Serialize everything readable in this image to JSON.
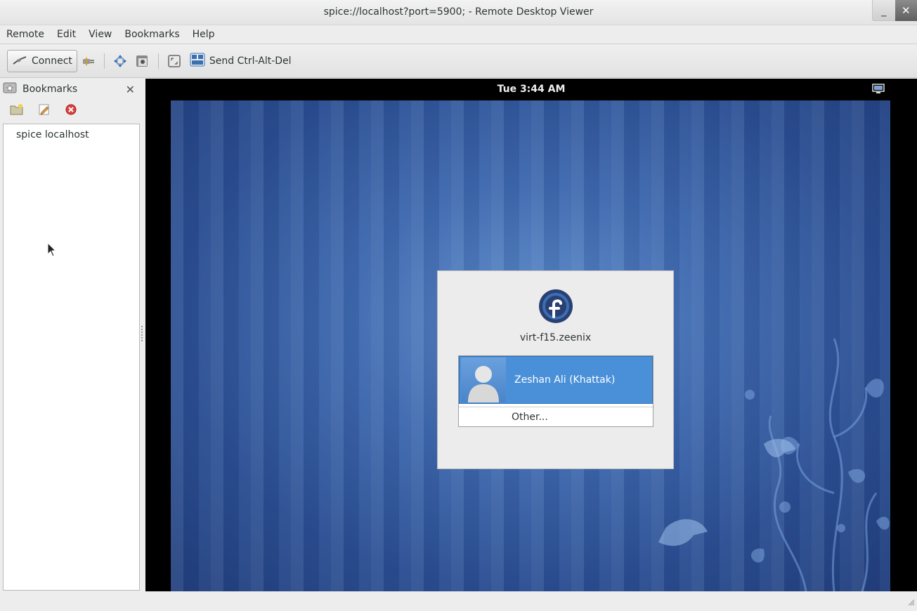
{
  "window": {
    "title": "spice://localhost?port=5900; - Remote Desktop Viewer",
    "minimize": "_",
    "close": "✕"
  },
  "menubar": {
    "items": [
      "Remote",
      "Edit",
      "View",
      "Bookmarks",
      "Help"
    ]
  },
  "toolbar": {
    "connect_label": "Connect",
    "send_keys_label": "Send Ctrl-Alt-Del"
  },
  "sidebar": {
    "title": "Bookmarks",
    "close": "✕",
    "bookmarks": [
      "spice localhost"
    ]
  },
  "remote": {
    "clock": "Tue  3:44 AM",
    "login": {
      "hostname": "virt-f15.zeenix",
      "users": [
        {
          "name": "Zeshan Ali (Khattak)",
          "selected": true
        }
      ],
      "other_label": "Other..."
    }
  },
  "colors": {
    "selection": "#4a90d9",
    "desktop_blue": "#3f6ab0"
  }
}
